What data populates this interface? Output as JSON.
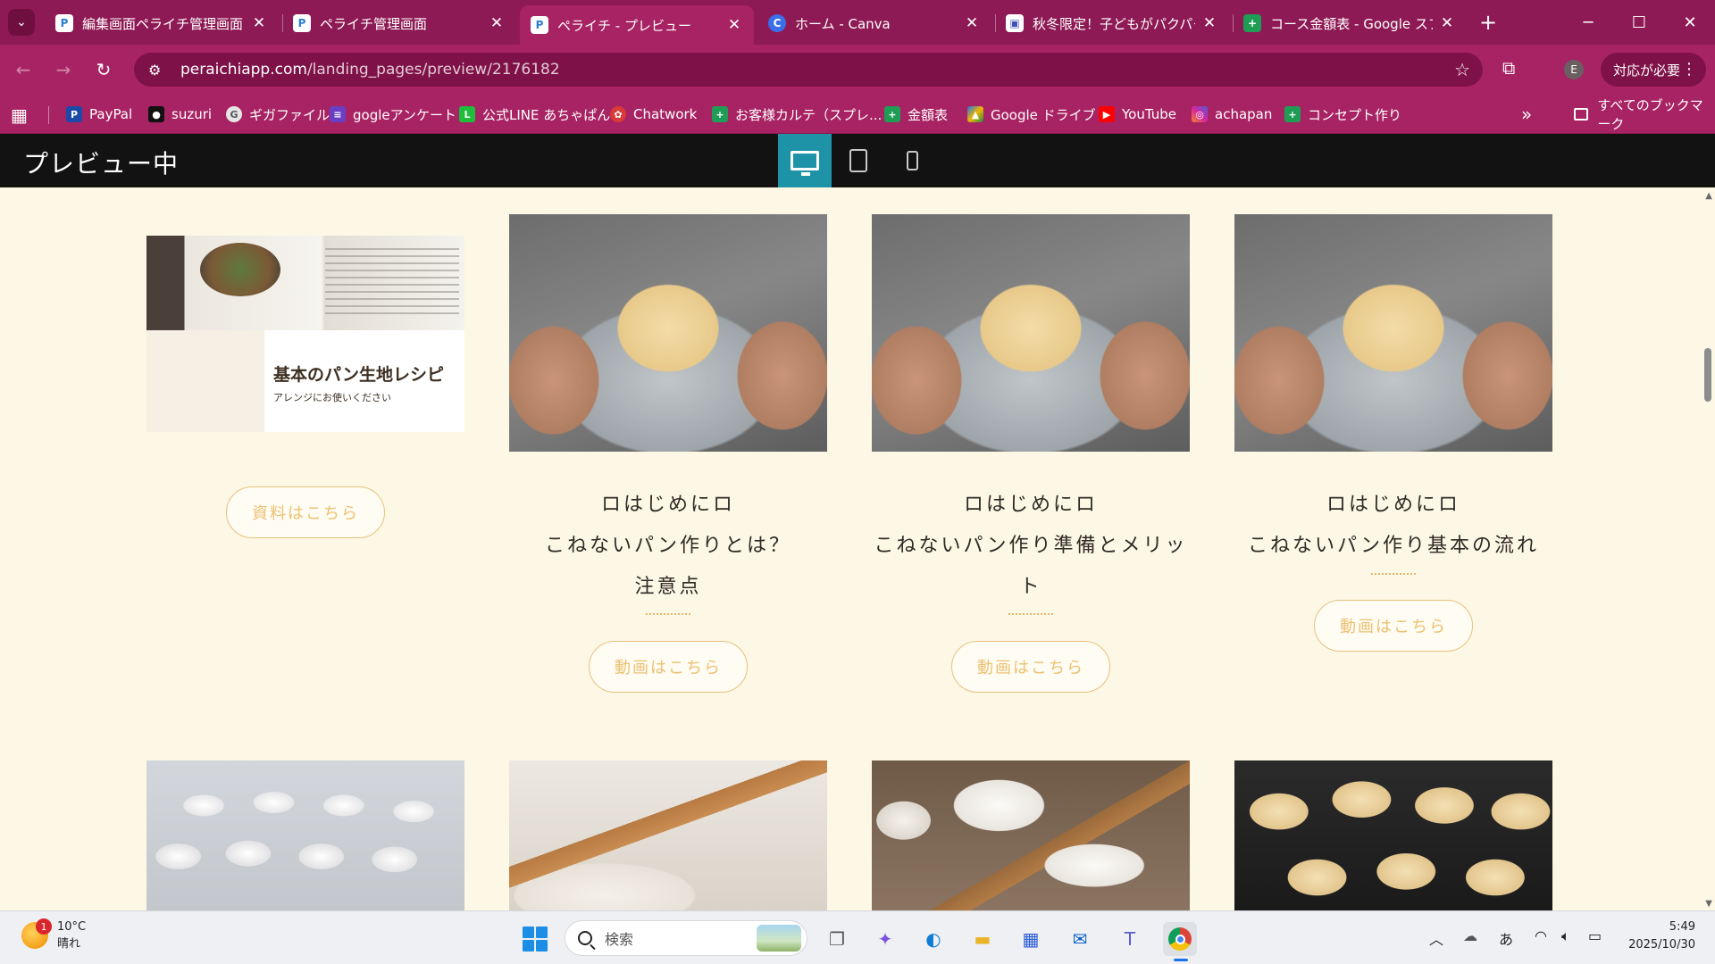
{
  "browser": {
    "tabs": [
      {
        "title": "編集画面ペライチ管理画面",
        "favicon": "peraichi-icon",
        "active": false
      },
      {
        "title": "ペライチ管理画面",
        "favicon": "peraichi-icon",
        "active": false
      },
      {
        "title": "ペライチ - プレビュー",
        "favicon": "peraichi-icon",
        "active": true
      },
      {
        "title": "ホーム - Canva",
        "favicon": "canva-icon",
        "active": false
      },
      {
        "title": "秋冬限定！子どもがパクパク",
        "favicon": "meet-icon",
        "active": false
      },
      {
        "title": "コース金額表 - Google スプレ",
        "favicon": "sheets-icon",
        "active": false
      }
    ],
    "url_host": "peraichiapp.com",
    "url_path": "/landing_pages/preview/2176182",
    "profile_initial": "E",
    "action_label": "対応が必要",
    "bookmarks": [
      {
        "label": "PayPal",
        "icon": "paypal-icon",
        "color": "#1b4aa8"
      },
      {
        "label": "suzuri",
        "icon": "suzuri-icon",
        "color": "#111111"
      },
      {
        "label": "ギガファイル",
        "icon": "gigafile-icon",
        "color": "#e6e6e6"
      },
      {
        "label": "gogleアンケート",
        "icon": "forms-icon",
        "color": "#6a3fc4"
      },
      {
        "label": "公式LINE あちゃぱん",
        "icon": "line-icon",
        "color": "#1ebd3a"
      },
      {
        "label": "Chatwork",
        "icon": "chatwork-icon",
        "color": "#d93a3a"
      },
      {
        "label": "お客様カルテ（スプレ...",
        "icon": "sheets-icon",
        "color": "#1f9d55"
      },
      {
        "label": "金額表",
        "icon": "sheets-icon",
        "color": "#1f9d55"
      },
      {
        "label": "Google ドライブ",
        "icon": "drive-icon",
        "color": "#f2b400"
      },
      {
        "label": "YouTube",
        "icon": "youtube-icon",
        "color": "#ff0000"
      },
      {
        "label": "achapan",
        "icon": "instagram-icon",
        "color": "#d6249f"
      },
      {
        "label": "コンセプト作り",
        "icon": "sheets-icon",
        "color": "#1f9d55"
      }
    ],
    "all_bookmarks_label": "すべてのブックマーク"
  },
  "preview": {
    "title": "プレビュー中",
    "devices": [
      "desktop-icon",
      "tablet-icon",
      "phone-icon"
    ],
    "active_device": "desktop-icon"
  },
  "content": {
    "recipe_card": {
      "title": "基本のパン生地レシピ",
      "subtitle": "アレンジにお使いください"
    },
    "cards": [
      {
        "lines": [],
        "button": "資料はこちら"
      },
      {
        "lines": [
          "ロはじめにロ",
          "こねないパン作りとは？",
          "注意点"
        ],
        "button": "動画はこちら"
      },
      {
        "lines": [
          "ロはじめにロ",
          "こねないパン作り準備とメリッ",
          "ト"
        ],
        "button": "動画はこちら"
      },
      {
        "lines": [
          "ロはじめにロ",
          "こねないパン作り基本の流れ"
        ],
        "button": "動画はこちら"
      }
    ],
    "accent_color": "#ecc172"
  },
  "taskbar": {
    "weather": {
      "temp": "10°C",
      "condition": "晴れ",
      "badge": "1"
    },
    "search_placeholder": "検索",
    "ime": "あ",
    "time": "5:49",
    "date": "2025/10/30"
  }
}
